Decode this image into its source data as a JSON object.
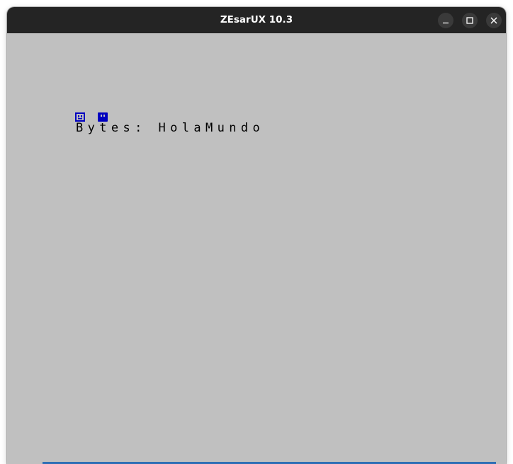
{
  "window": {
    "title": "ZEsarUX 10.3",
    "controls": {
      "minimize_icon": "minimize-icon",
      "maximize_icon": "maximize-icon",
      "close_icon": "close-icon"
    }
  },
  "emulator": {
    "screen_text": "Bytes: HolaMundo",
    "paper_color": "#c0c0c0",
    "ink_color": "#000000",
    "sprite_color": "#0000c0"
  }
}
